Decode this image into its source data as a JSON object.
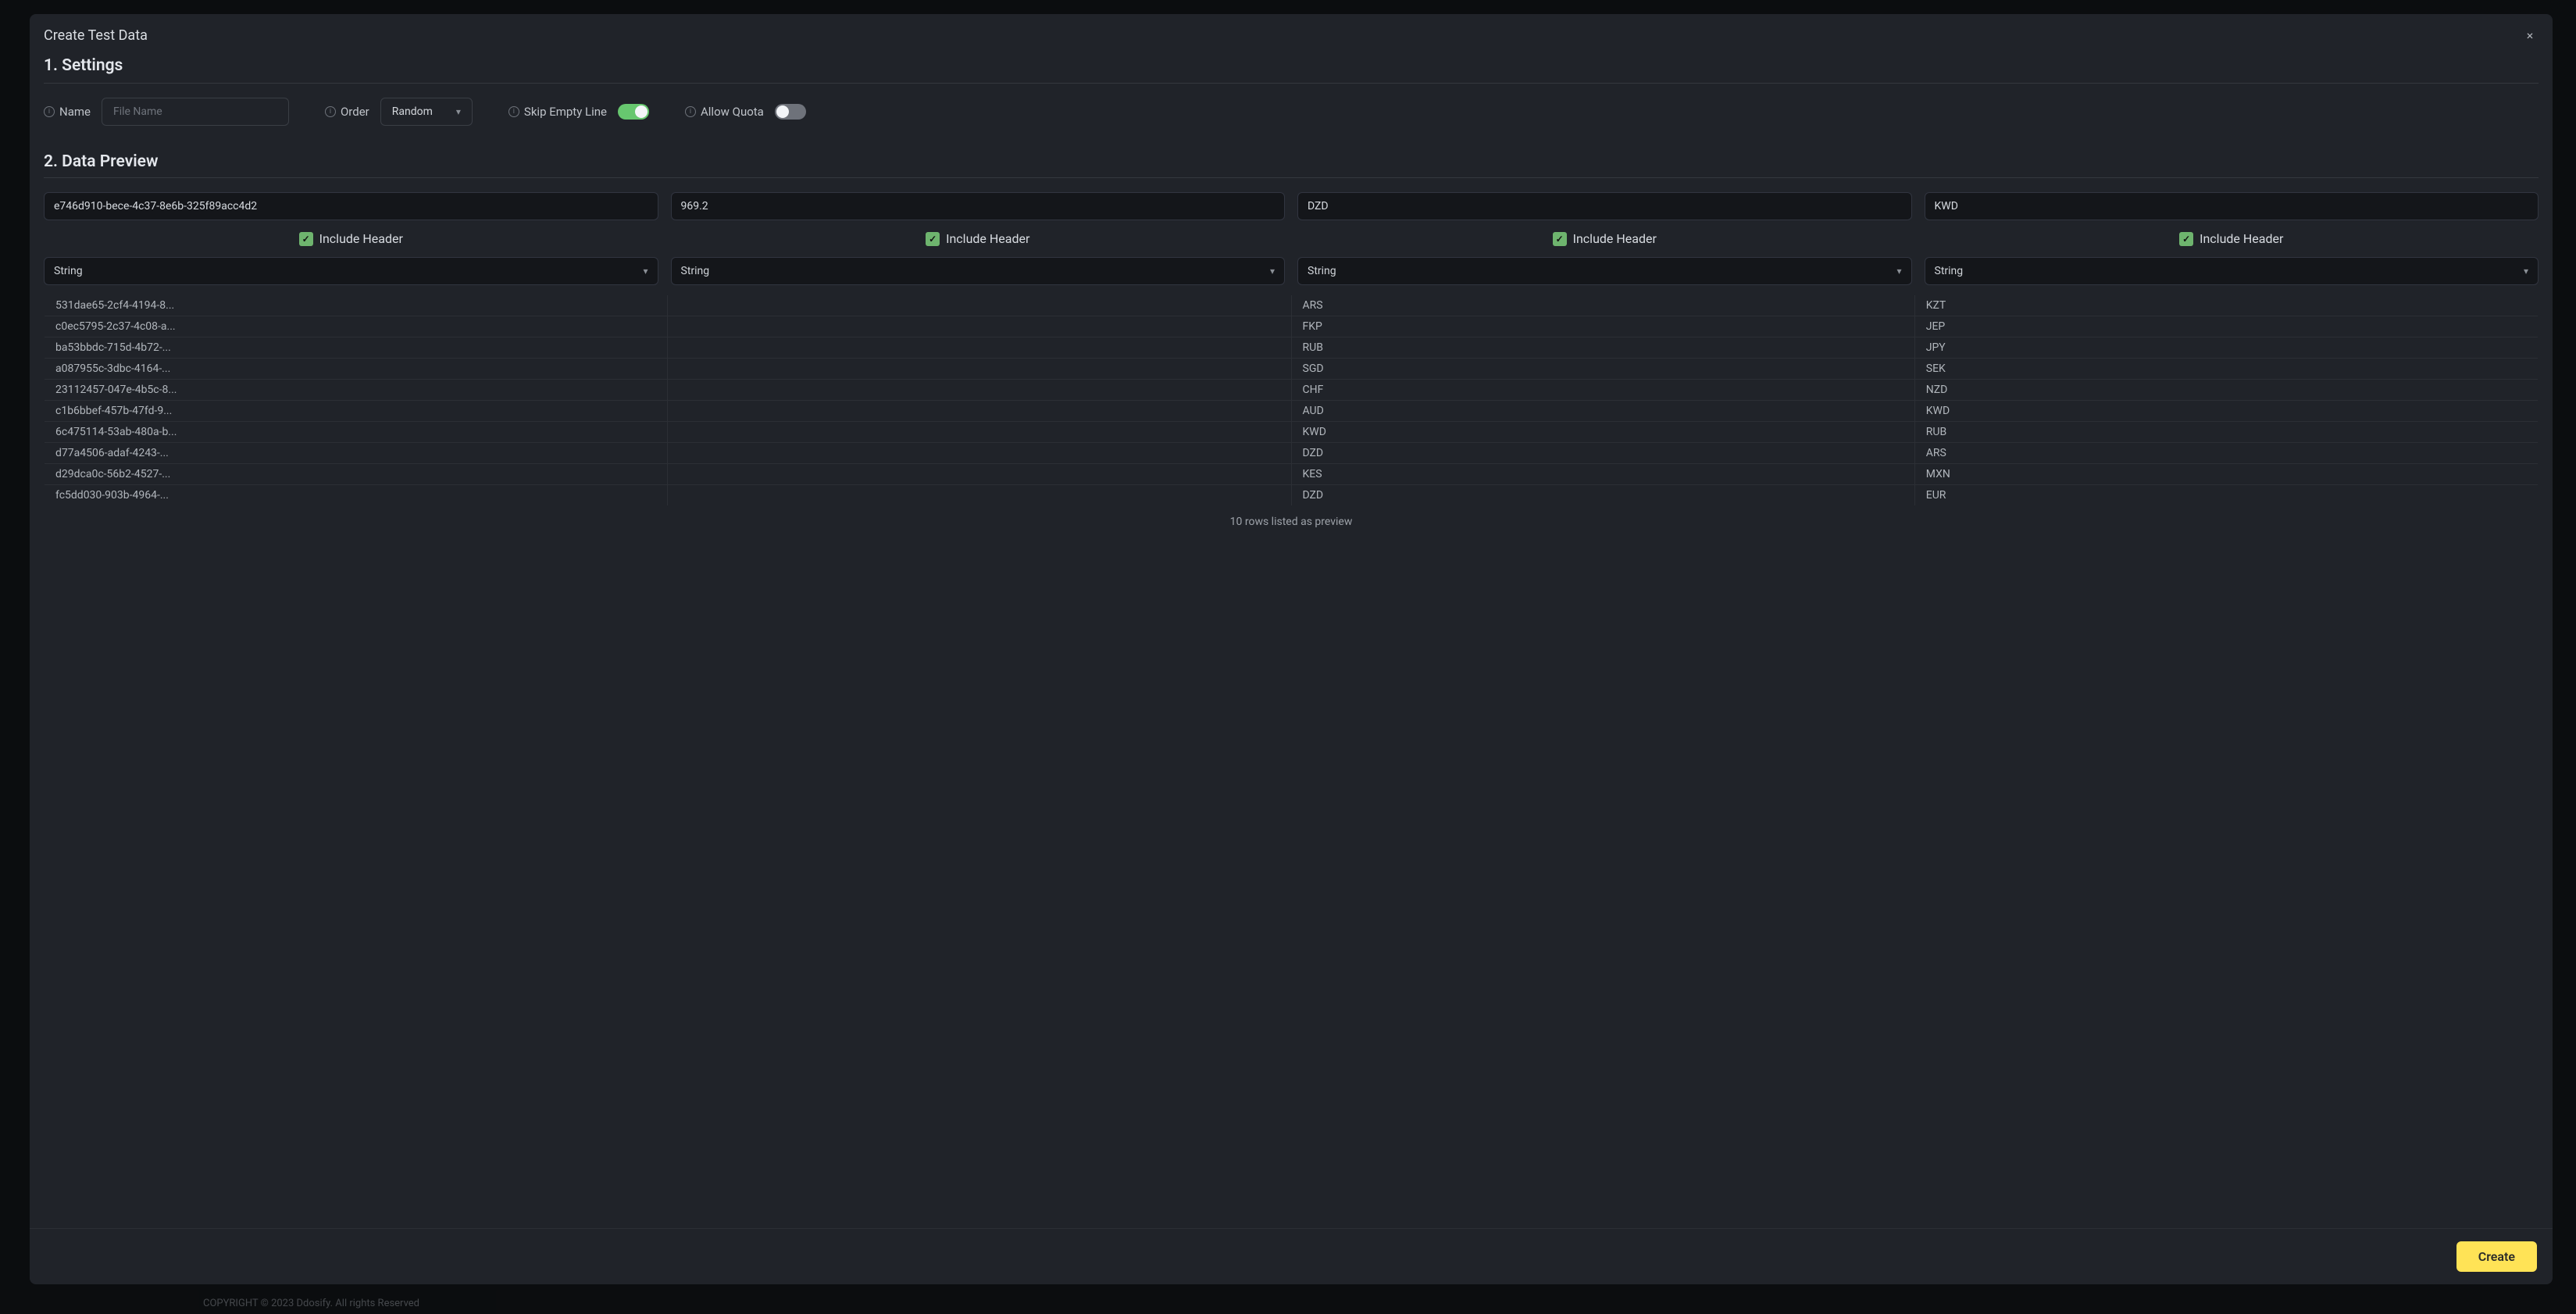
{
  "modal": {
    "title": "Create Test Data",
    "close_label": "×",
    "create_btn": "Create",
    "settings_label": "1. Settings",
    "name_label": "Name",
    "name_placeholder": "File Name",
    "name_value": "",
    "order_label": "Order",
    "order_value": "Random",
    "skip_label": "Skip Empty Line",
    "skip_on": true,
    "quota_label": "Allow Quota",
    "quota_on": false,
    "preview_label": "2. Data Preview",
    "include_header_label": "Include Header",
    "columns": [
      {
        "header": "e746d910-bece-4c37-8e6b-325f89acc4d2",
        "type": "String"
      },
      {
        "header": "969.2",
        "type": "String"
      },
      {
        "header": "DZD",
        "type": "String"
      },
      {
        "header": "KWD",
        "type": "String"
      }
    ],
    "rows": [
      [
        "531dae65-2cf4-4194-8...",
        "",
        "ARS",
        "KZT"
      ],
      [
        "c0ec5795-2c37-4c08-a...",
        "",
        "FKP",
        "JEP"
      ],
      [
        "ba53bbdc-715d-4b72-...",
        "",
        "RUB",
        "JPY"
      ],
      [
        "a087955c-3dbc-4164-...",
        "",
        "SGD",
        "SEK"
      ],
      [
        "23112457-047e-4b5c-8...",
        "",
        "CHF",
        "NZD"
      ],
      [
        "c1b6bbef-457b-47fd-9...",
        "",
        "AUD",
        "KWD"
      ],
      [
        "6c475114-53ab-480a-b...",
        "",
        "KWD",
        "RUB"
      ],
      [
        "d77a4506-adaf-4243-...",
        "",
        "DZD",
        "ARS"
      ],
      [
        "d29dca0c-56b2-4527-...",
        "",
        "KES",
        "MXN"
      ],
      [
        "fc5dd030-903b-4964-...",
        "",
        "DZD",
        "EUR"
      ]
    ],
    "row_caption": "10 rows listed as preview"
  },
  "footer": "COPYRIGHT © 2023 Ddosify. All rights Reserved"
}
